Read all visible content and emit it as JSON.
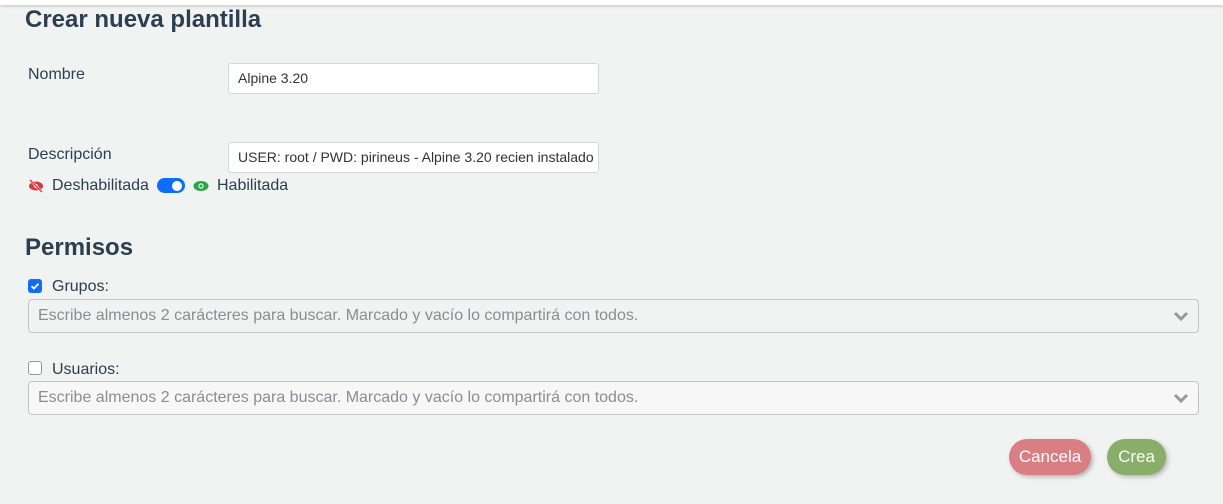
{
  "title": "Crear nueva plantilla",
  "name": {
    "label": "Nombre",
    "value": "Alpine 3.20"
  },
  "description": {
    "label": "Descripción",
    "value": "USER: root / PWD: pirineus - Alpine 3.20 recien instalado"
  },
  "toggle": {
    "off_label": "Deshabilitada",
    "on_label": "Habilitada",
    "enabled": true
  },
  "permissions": {
    "title": "Permisos",
    "groups": {
      "label": "Grupos:",
      "checked": true,
      "placeholder": "Escribe almenos 2 carácteres para buscar. Marcado y vacío lo compartirá con todos."
    },
    "users": {
      "label": "Usuarios:",
      "checked": false,
      "placeholder": "Escribe almenos 2 carácteres para buscar. Marcado y vacío lo compartirá con todos."
    }
  },
  "buttons": {
    "cancel": "Cancela",
    "create": "Crea"
  },
  "colors": {
    "cancel": "#d97f84",
    "create": "#88ae6a",
    "accent": "#0d6efd"
  }
}
